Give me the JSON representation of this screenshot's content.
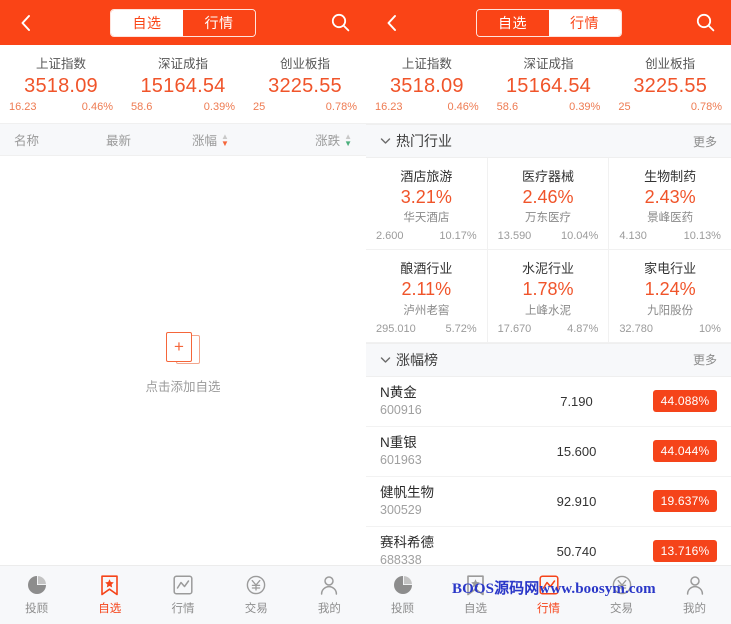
{
  "theme": {
    "primary": "#FA4416",
    "badge": "#F5441A",
    "up": "#F0542A",
    "muted": "#9a9a9a"
  },
  "header": {
    "back_icon": "chevron-left-icon",
    "search_icon": "search-icon",
    "tabs": [
      {
        "label": "自选",
        "key": "watchlist"
      },
      {
        "label": "行情",
        "key": "market"
      }
    ]
  },
  "indices": [
    {
      "name": "上证指数",
      "value": "3518.09",
      "change": "16.23",
      "percent": "0.46%"
    },
    {
      "name": "深证成指",
      "value": "15164.54",
      "change": "58.6",
      "percent": "0.39%"
    },
    {
      "name": "创业板指",
      "value": "3225.55",
      "change": "25",
      "percent": "0.78%"
    }
  ],
  "left_panel": {
    "active_tab": "自选",
    "table_header": [
      {
        "label": "名称",
        "sortable": false
      },
      {
        "label": "最新",
        "sortable": false
      },
      {
        "label": "涨幅",
        "sortable": true,
        "sort_color": "#F5663A"
      },
      {
        "label": "涨跌",
        "sortable": true,
        "sort_color": "#4CAF7D"
      }
    ],
    "empty_state": {
      "icon": "add-card-icon",
      "text": "点击添加自选"
    },
    "active_nav": "自选"
  },
  "right_panel": {
    "active_tab": "自选",
    "sections": [
      {
        "title": "热门行业",
        "more": "更多",
        "chevron": "chevron-down-icon"
      },
      {
        "title": "涨幅榜",
        "more": "更多",
        "chevron": "chevron-down-icon"
      }
    ],
    "industries": [
      {
        "name": "酒店旅游",
        "percent": "3.21%",
        "stock": "华天酒店",
        "price": "2.600",
        "stock_percent": "10.17%"
      },
      {
        "name": "医疗器械",
        "percent": "2.46%",
        "stock": "万东医疗",
        "price": "13.590",
        "stock_percent": "10.04%"
      },
      {
        "name": "生物制药",
        "percent": "2.43%",
        "stock": "景峰医药",
        "price": "4.130",
        "stock_percent": "10.13%"
      },
      {
        "name": "酿酒行业",
        "percent": "2.11%",
        "stock": "泸州老窖",
        "price": "295.010",
        "stock_percent": "5.72%"
      },
      {
        "name": "水泥行业",
        "percent": "1.78%",
        "stock": "上峰水泥",
        "price": "17.670",
        "stock_percent": "4.87%"
      },
      {
        "name": "家电行业",
        "percent": "1.24%",
        "stock": "九阳股份",
        "price": "32.780",
        "stock_percent": "10%"
      }
    ],
    "gainers": [
      {
        "name": "N黄金",
        "code": "600916",
        "price": "7.190",
        "percent": "44.088%"
      },
      {
        "name": "N重银",
        "code": "601963",
        "price": "15.600",
        "percent": "44.044%"
      },
      {
        "name": "健帆生物",
        "code": "300529",
        "price": "92.910",
        "percent": "19.637%"
      },
      {
        "name": "赛科希德",
        "code": "688338",
        "price": "50.740",
        "percent": "13.716%"
      }
    ],
    "active_nav": "行情"
  },
  "bottom_nav": [
    {
      "label": "投顾",
      "icon": "pie-chart-icon"
    },
    {
      "label": "自选",
      "icon": "bookmark-star-icon"
    },
    {
      "label": "行情",
      "icon": "line-chart-icon"
    },
    {
      "label": "交易",
      "icon": "yen-circle-icon"
    },
    {
      "label": "我的",
      "icon": "person-icon"
    }
  ],
  "watermark": {
    "text": "BOOS源码网www.boosym.com"
  }
}
